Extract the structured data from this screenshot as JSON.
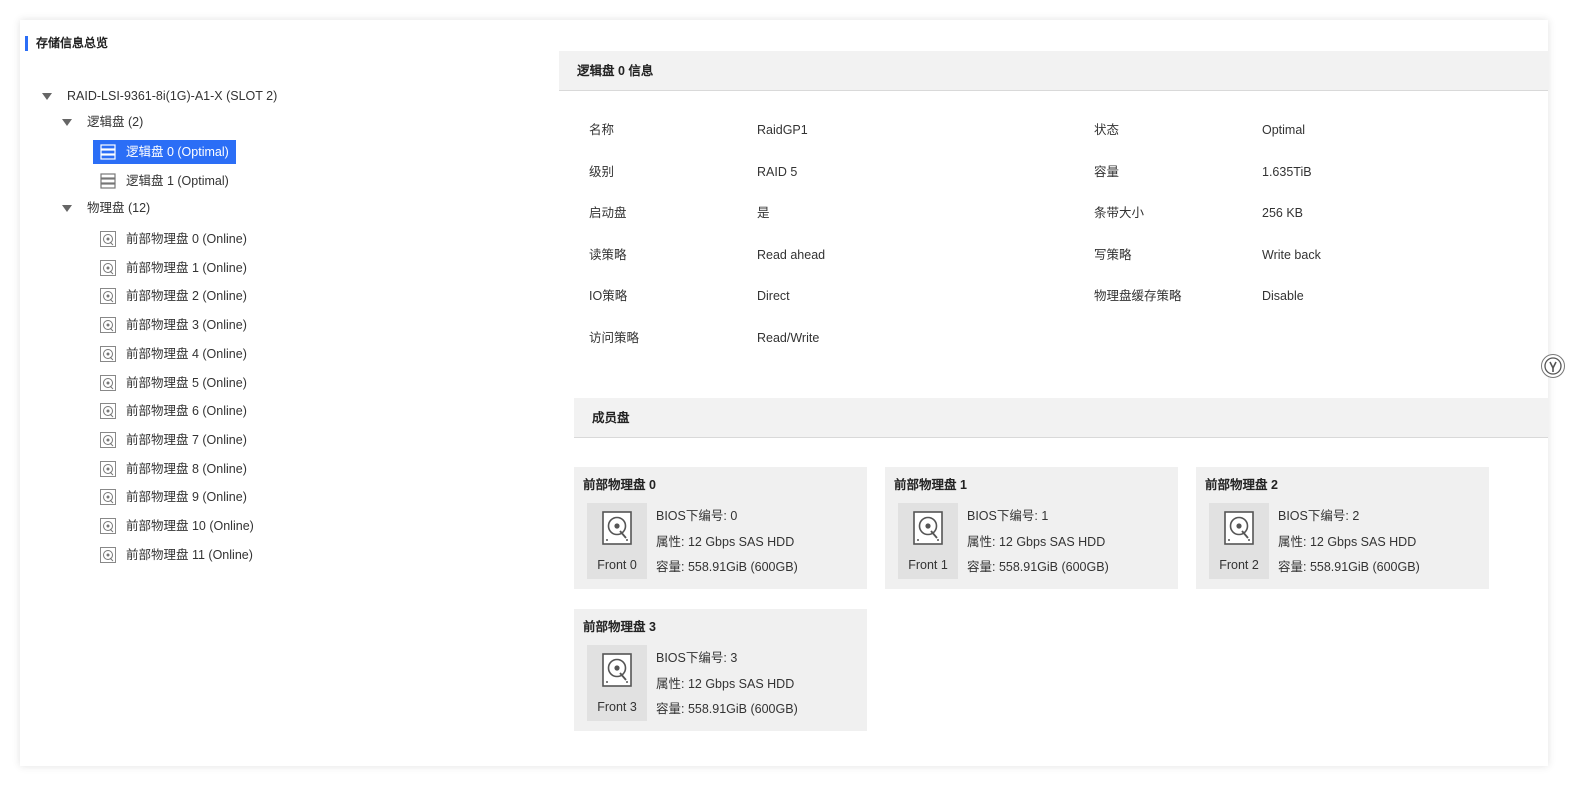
{
  "overview_title": "存储信息总览",
  "tree": {
    "controller": "RAID-LSI-9361-8i(1G)-A1-X (SLOT 2)",
    "logical_group": "逻辑盘 (2)",
    "logical_disks": [
      "逻辑盘 0 (Optimal)",
      "逻辑盘 1 (Optimal)"
    ],
    "physical_group": "物理盘 (12)",
    "physical_disks": [
      "前部物理盘 0 (Online)",
      "前部物理盘 1 (Online)",
      "前部物理盘 2 (Online)",
      "前部物理盘 3 (Online)",
      "前部物理盘 4 (Online)",
      "前部物理盘 5 (Online)",
      "前部物理盘 6 (Online)",
      "前部物理盘 7 (Online)",
      "前部物理盘 8 (Online)",
      "前部物理盘 9 (Online)",
      "前部物理盘 10 (Online)",
      "前部物理盘 11 (Online)"
    ],
    "selected": "逻辑盘 0 (Optimal)"
  },
  "info": {
    "title": "逻辑盘 0 信息",
    "rows": [
      {
        "l1": "名称",
        "v1": "RaidGP1",
        "l2": "状态",
        "v2": "Optimal"
      },
      {
        "l1": "级别",
        "v1": "RAID 5",
        "l2": "容量",
        "v2": "1.635TiB"
      },
      {
        "l1": "启动盘",
        "v1": "是",
        "l2": "条带大小",
        "v2": "256 KB"
      },
      {
        "l1": "读策略",
        "v1": "Read ahead",
        "l2": "写策略",
        "v2": "Write back"
      },
      {
        "l1": "IO策略",
        "v1": "Direct",
        "l2": "物理盘缓存策略",
        "v2": "Disable"
      },
      {
        "l1": "访问策略",
        "v1": "Read/Write",
        "l2": "",
        "v2": ""
      }
    ]
  },
  "members": {
    "title": "成员盘",
    "disks": [
      {
        "name": "前部物理盘 0",
        "tile": "Front 0",
        "bios": "BIOS下编号: 0",
        "attr": "属性: 12 Gbps SAS HDD",
        "cap": "容量: 558.91GiB (600GB)"
      },
      {
        "name": "前部物理盘 1",
        "tile": "Front 1",
        "bios": "BIOS下编号: 1",
        "attr": "属性: 12 Gbps SAS HDD",
        "cap": "容量: 558.91GiB (600GB)"
      },
      {
        "name": "前部物理盘 2",
        "tile": "Front 2",
        "bios": "BIOS下编号: 2",
        "attr": "属性: 12 Gbps SAS HDD",
        "cap": "容量: 558.91GiB (600GB)"
      },
      {
        "name": "前部物理盘 3",
        "tile": "Front 3",
        "bios": "BIOS下编号: 3",
        "attr": "属性: 12 Gbps SAS HDD",
        "cap": "容量: 558.91GiB (600GB)"
      }
    ]
  },
  "colors": {
    "accent": "#2b6ef6",
    "panel_bg": "#f2f2f2",
    "card_bg": "#f0f0f0"
  },
  "icons": {
    "logical_disk": "server-stack-icon",
    "physical_disk": "hard-disk-icon",
    "help": "help-icon"
  }
}
